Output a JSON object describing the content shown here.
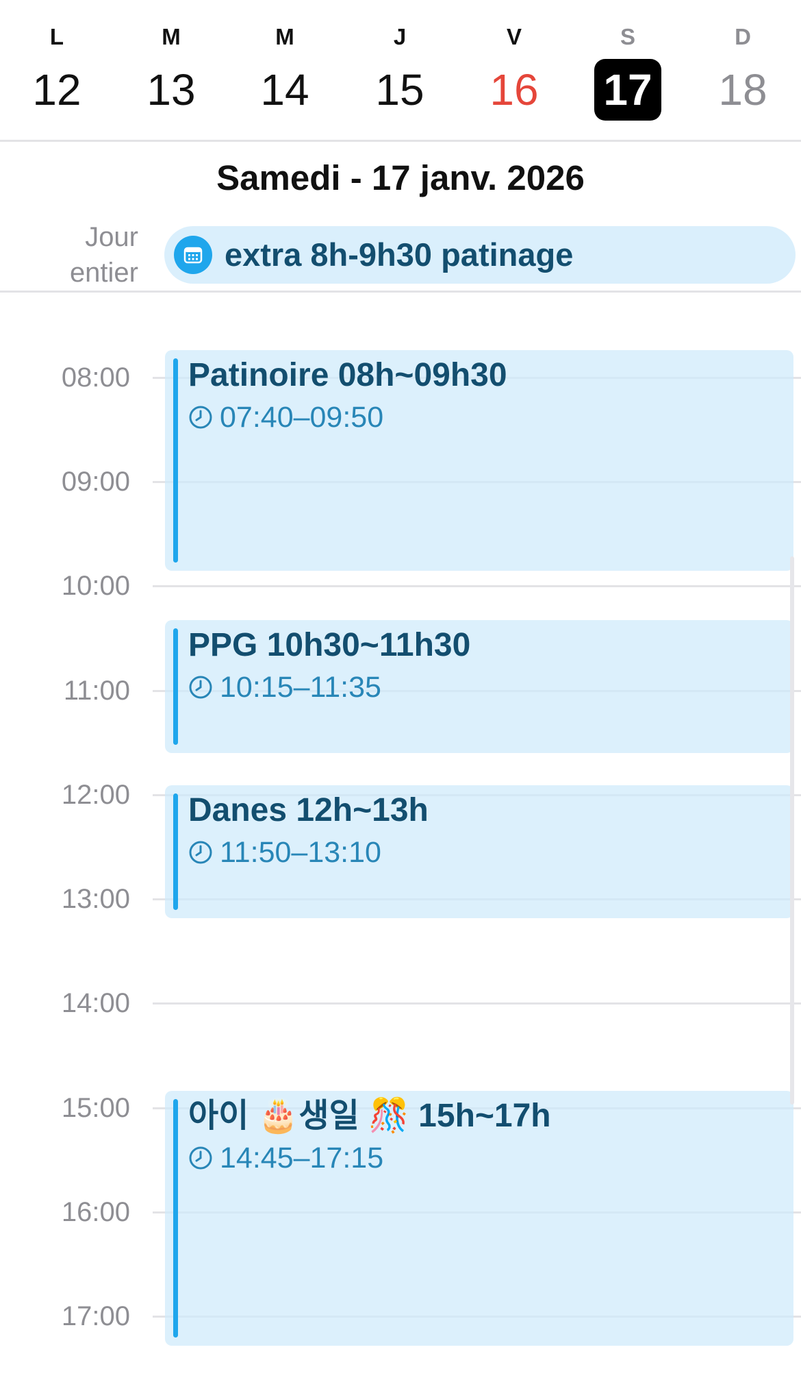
{
  "week": {
    "days": [
      {
        "letter": "L",
        "number": "12",
        "state": "normal"
      },
      {
        "letter": "M",
        "number": "13",
        "state": "normal"
      },
      {
        "letter": "M",
        "number": "14",
        "state": "normal"
      },
      {
        "letter": "J",
        "number": "15",
        "state": "normal"
      },
      {
        "letter": "V",
        "number": "16",
        "state": "today"
      },
      {
        "letter": "S",
        "number": "17",
        "state": "selected"
      },
      {
        "letter": "D",
        "number": "18",
        "state": "muted"
      }
    ]
  },
  "date_heading": "Samedi - 17 janv. 2026",
  "all_day": {
    "label_line1": "Jour",
    "label_line2": "entier",
    "event_title": "extra 8h-9h30 patinage",
    "icon": "calendar-icon"
  },
  "hours": [
    "08:00",
    "09:00",
    "10:00",
    "11:00",
    "12:00",
    "13:00",
    "14:00",
    "15:00",
    "16:00",
    "17:00"
  ],
  "events": [
    {
      "title": "Patinoire 08h~09h30",
      "time": "07:40–09:50",
      "icon": "clock-icon"
    },
    {
      "title": "PPG 10h30~11h30",
      "time": "10:15–11:35",
      "icon": "clock-icon"
    },
    {
      "title": "Danes 12h~13h",
      "time": "11:50–13:10",
      "icon": "clock-icon"
    },
    {
      "title": "아이 🎂생일 🎊 15h~17h",
      "time": "14:45–17:15",
      "icon": "clock-icon"
    }
  ],
  "colors": {
    "accent": "#1fa6ec",
    "event_bg": "#daeffc",
    "event_title": "#134e6f",
    "event_time": "#2886b7",
    "today": "#e5463a",
    "muted": "#8e8e93"
  }
}
